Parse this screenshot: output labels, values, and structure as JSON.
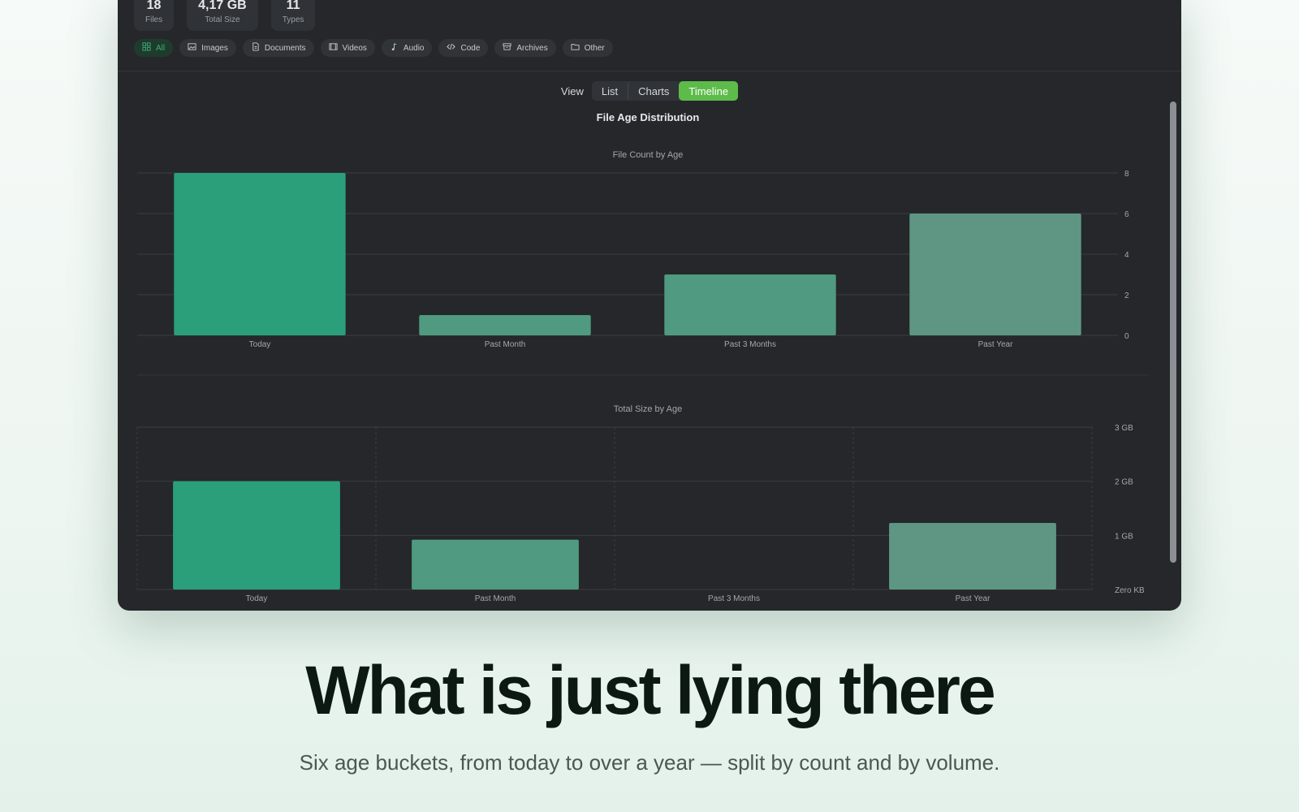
{
  "stats": [
    {
      "value": "18",
      "label": "Files"
    },
    {
      "value": "4,17 GB",
      "label": "Total Size"
    },
    {
      "value": "11",
      "label": "Types"
    }
  ],
  "filters": [
    {
      "label": "All",
      "icon": "grid-icon",
      "active": true
    },
    {
      "label": "Images",
      "icon": "image-icon"
    },
    {
      "label": "Documents",
      "icon": "document-icon"
    },
    {
      "label": "Videos",
      "icon": "film-icon"
    },
    {
      "label": "Audio",
      "icon": "music-note-icon"
    },
    {
      "label": "Code",
      "icon": "code-icon"
    },
    {
      "label": "Archives",
      "icon": "archive-icon"
    },
    {
      "label": "Other",
      "icon": "folder-icon"
    }
  ],
  "view": {
    "label": "View",
    "options": [
      "List",
      "Charts",
      "Timeline"
    ],
    "selected": "Timeline"
  },
  "colors": {
    "accent": "#5dbb4a",
    "bar_bright": "#2a9f79",
    "bar_mid": "#4f9a80",
    "bar_muted": "#5e9683"
  },
  "chart_data": [
    {
      "type": "bar",
      "title": "File Age Distribution",
      "subtitle": "File Count by Age",
      "categories": [
        "Today",
        "Past Month",
        "Past 3 Months",
        "Past Year"
      ],
      "values": [
        8,
        1,
        3,
        6
      ],
      "ylim": [
        0,
        8
      ],
      "yticks": [
        "0",
        "2",
        "4",
        "6",
        "8"
      ],
      "grid": true,
      "y_axis_position": "right"
    },
    {
      "type": "bar",
      "subtitle": "Total Size by Age",
      "categories": [
        "Today",
        "Past Month",
        "Past 3 Months",
        "Past Year"
      ],
      "values": [
        2.0,
        0.92,
        0,
        1.23
      ],
      "unit": "GB",
      "ylim": [
        0,
        3
      ],
      "yticks": [
        "Zero KB",
        "1 GB",
        "2 GB",
        "3 GB"
      ],
      "grid": true,
      "y_axis_position": "right"
    }
  ],
  "headline": "What is just lying there",
  "subline": "Six age buckets, from today to over a year — split by count and by volume."
}
